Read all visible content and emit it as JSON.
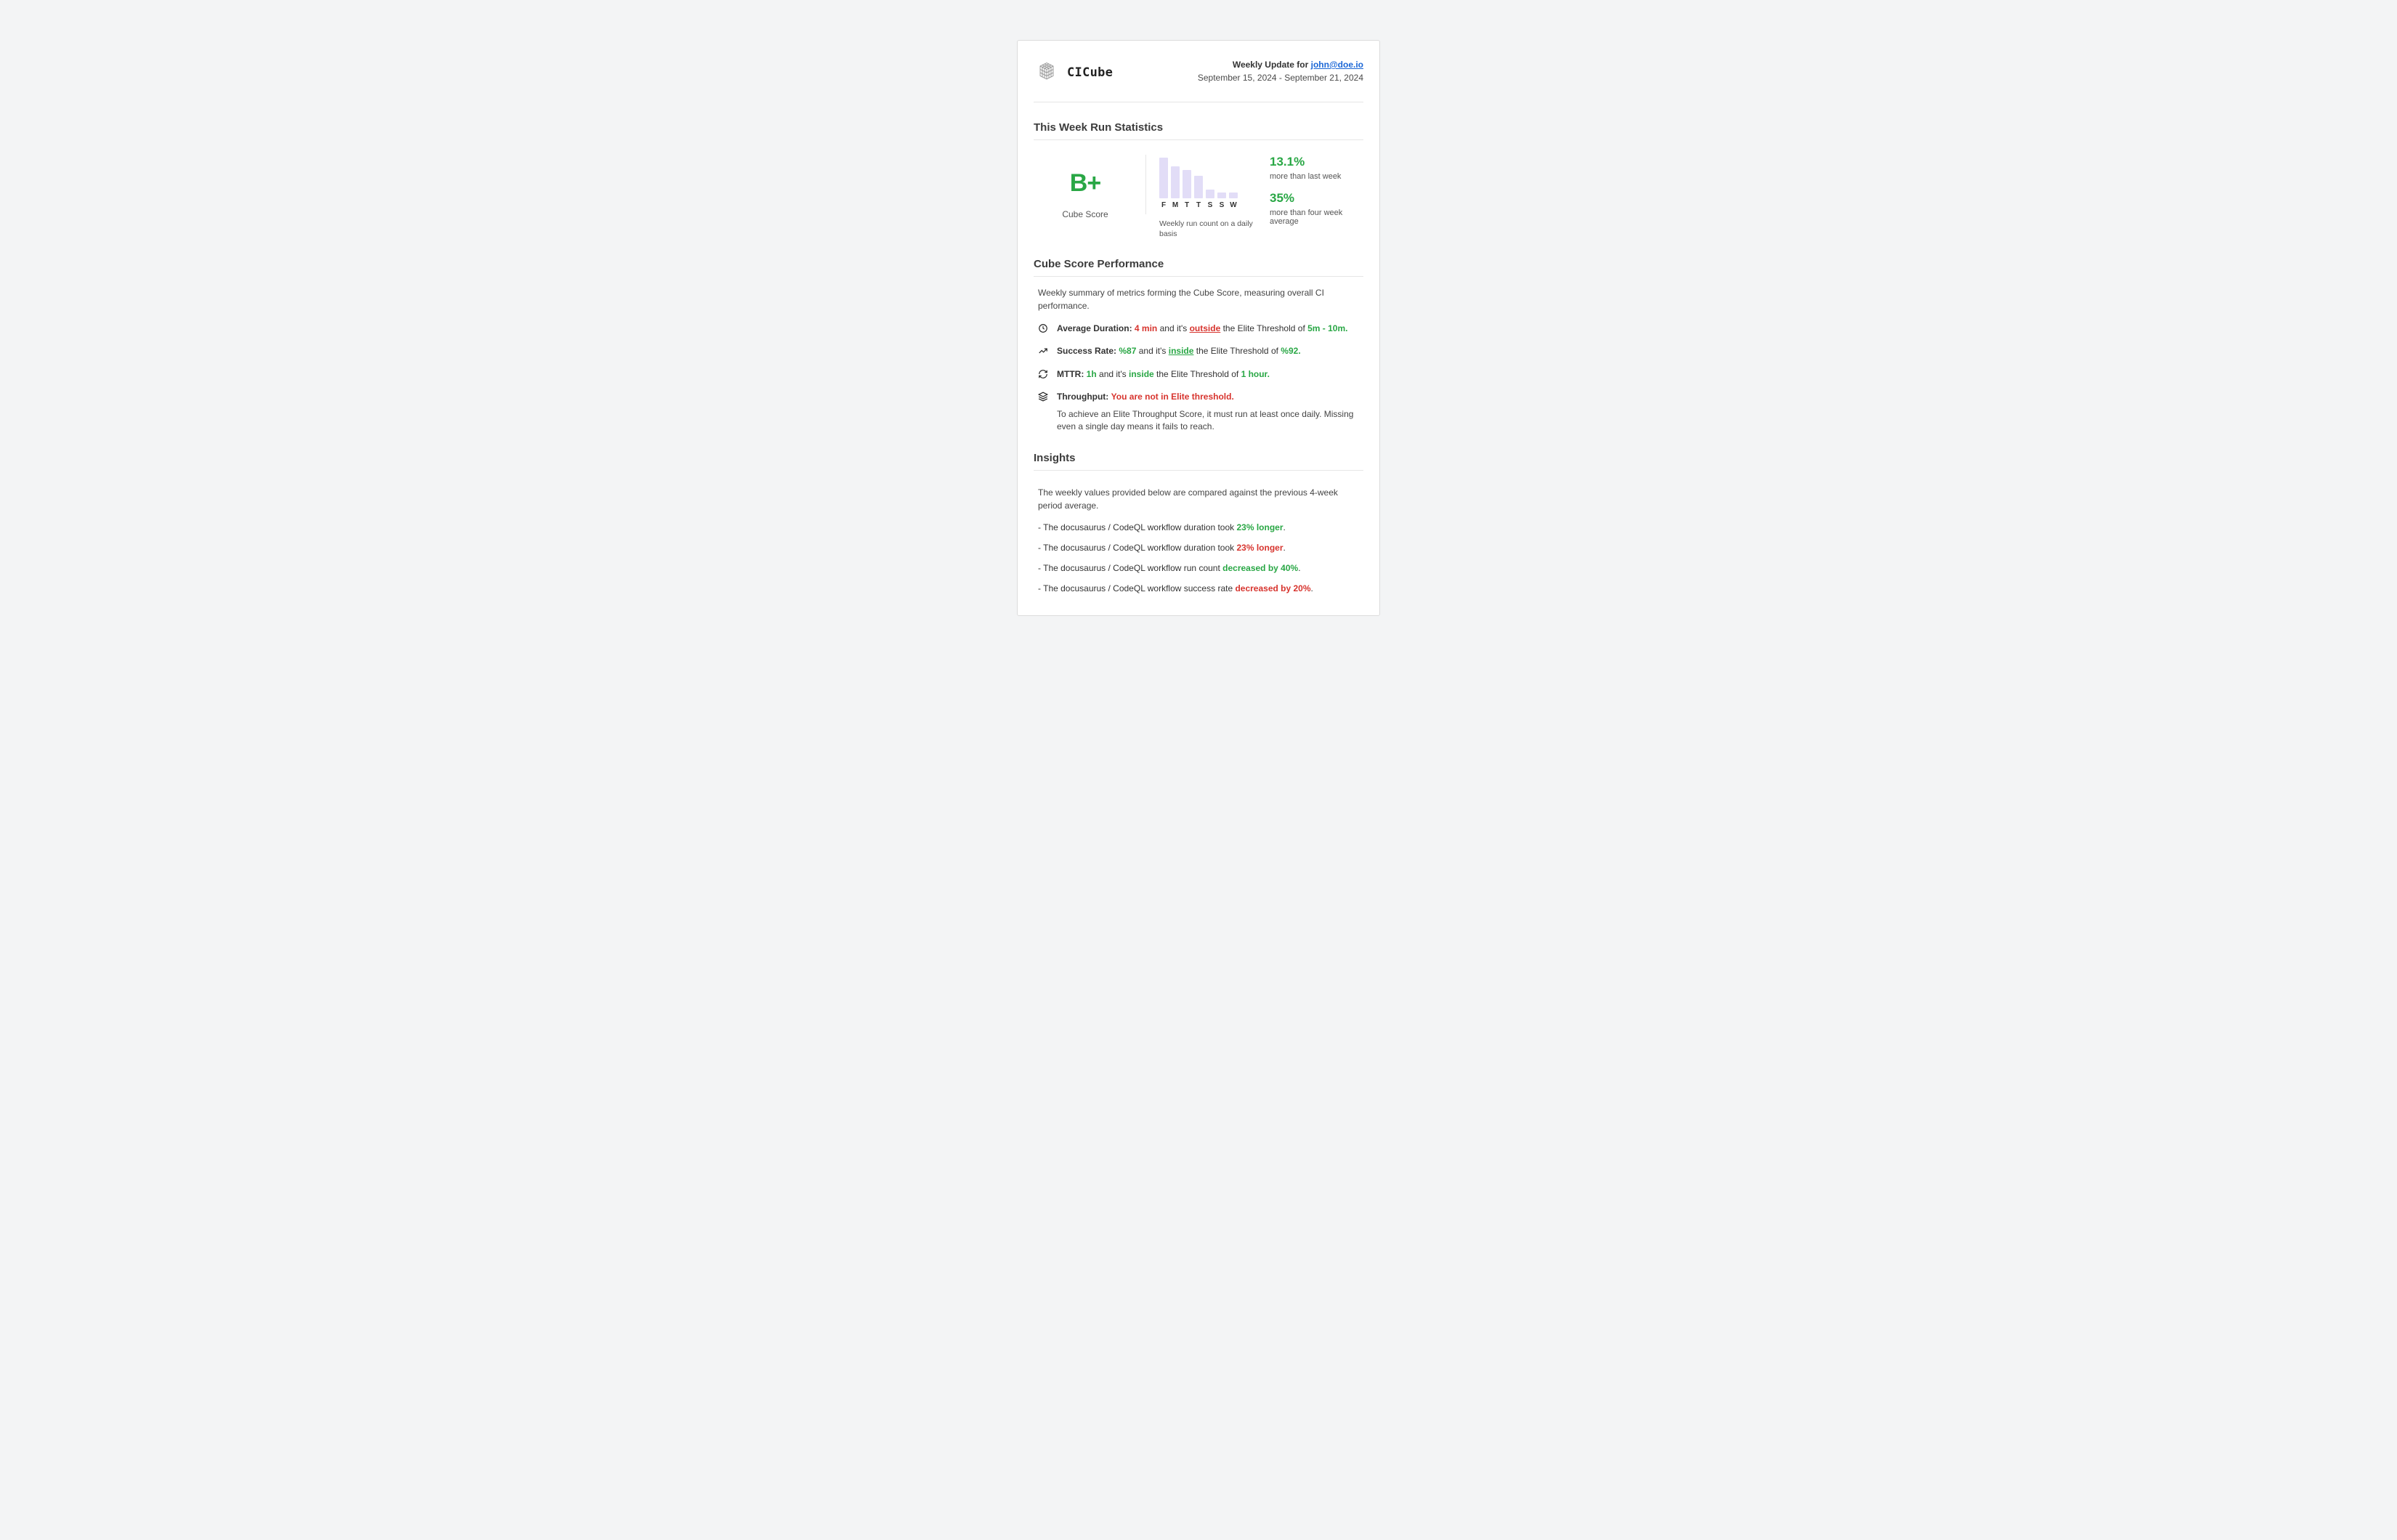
{
  "brand": {
    "name": "CICube"
  },
  "header": {
    "weekly_prefix": "Weekly Update for ",
    "email": "john@doe.io",
    "date_range": "September 15, 2024 - September 21, 2024"
  },
  "stats": {
    "title": "This Week Run Statistics",
    "grade": "B+",
    "grade_label": "Cube Score",
    "chart_caption": "Weekly run count on a daily basis",
    "delta_week_pct": "13.1%",
    "delta_week_label": "more than last week",
    "delta_4w_pct": "35%",
    "delta_4w_label": "more than four week average"
  },
  "chart_data": {
    "type": "bar",
    "categories": [
      "F",
      "M",
      "T",
      "T",
      "S",
      "S",
      "W"
    ],
    "values": [
      58,
      46,
      40,
      32,
      12,
      8,
      8
    ],
    "title": "Weekly run count on a daily basis",
    "xlabel": "",
    "ylabel": "",
    "ylim": [
      0,
      60
    ]
  },
  "perf": {
    "title": "Cube Score Performance",
    "intro": "Weekly summary of metrics forming the Cube Score, measuring overall CI performance.",
    "avg_duration": {
      "label": "Average Duration:",
      "value": "4 min",
      "mid": " and it's ",
      "status": "outside",
      "tail": " the Elite Threshold of ",
      "threshold": "5m - 10m."
    },
    "success_rate": {
      "label": "Success Rate:",
      "value": "%87",
      "mid": " and it's ",
      "status": "inside",
      "tail": " the Elite Threshold of ",
      "threshold": "%92."
    },
    "mttr": {
      "label": "MTTR:",
      "value": "1h",
      "mid": " and it's ",
      "status": "inside",
      "tail": " the Elite Threshold of ",
      "threshold": "1 hour."
    },
    "throughput": {
      "label": "Throughput:",
      "status": "You are not in Elite threshold.",
      "note": "To achieve an Elite Throughput Score, it must run at least once daily. Missing even a single day means it fails to reach."
    }
  },
  "insights": {
    "title": "Insights",
    "intro": "The weekly values provided below are compared against the previous 4-week period average.",
    "items": [
      {
        "prefix": "- The docusaurus / CodeQL workflow duration took ",
        "delta": "23% longer",
        "suffix": ".",
        "color": "green"
      },
      {
        "prefix": "- The docusaurus / CodeQL workflow duration took ",
        "delta": "23% longer",
        "suffix": ".",
        "color": "red"
      },
      {
        "prefix": "- The docusaurus / CodeQL workflow run count ",
        "delta": "decreased by 40%",
        "suffix": ".",
        "color": "green"
      },
      {
        "prefix": "- The docusaurus / CodeQL workflow success rate ",
        "delta": "decreased by 20%",
        "suffix": ".",
        "color": "red"
      }
    ]
  }
}
